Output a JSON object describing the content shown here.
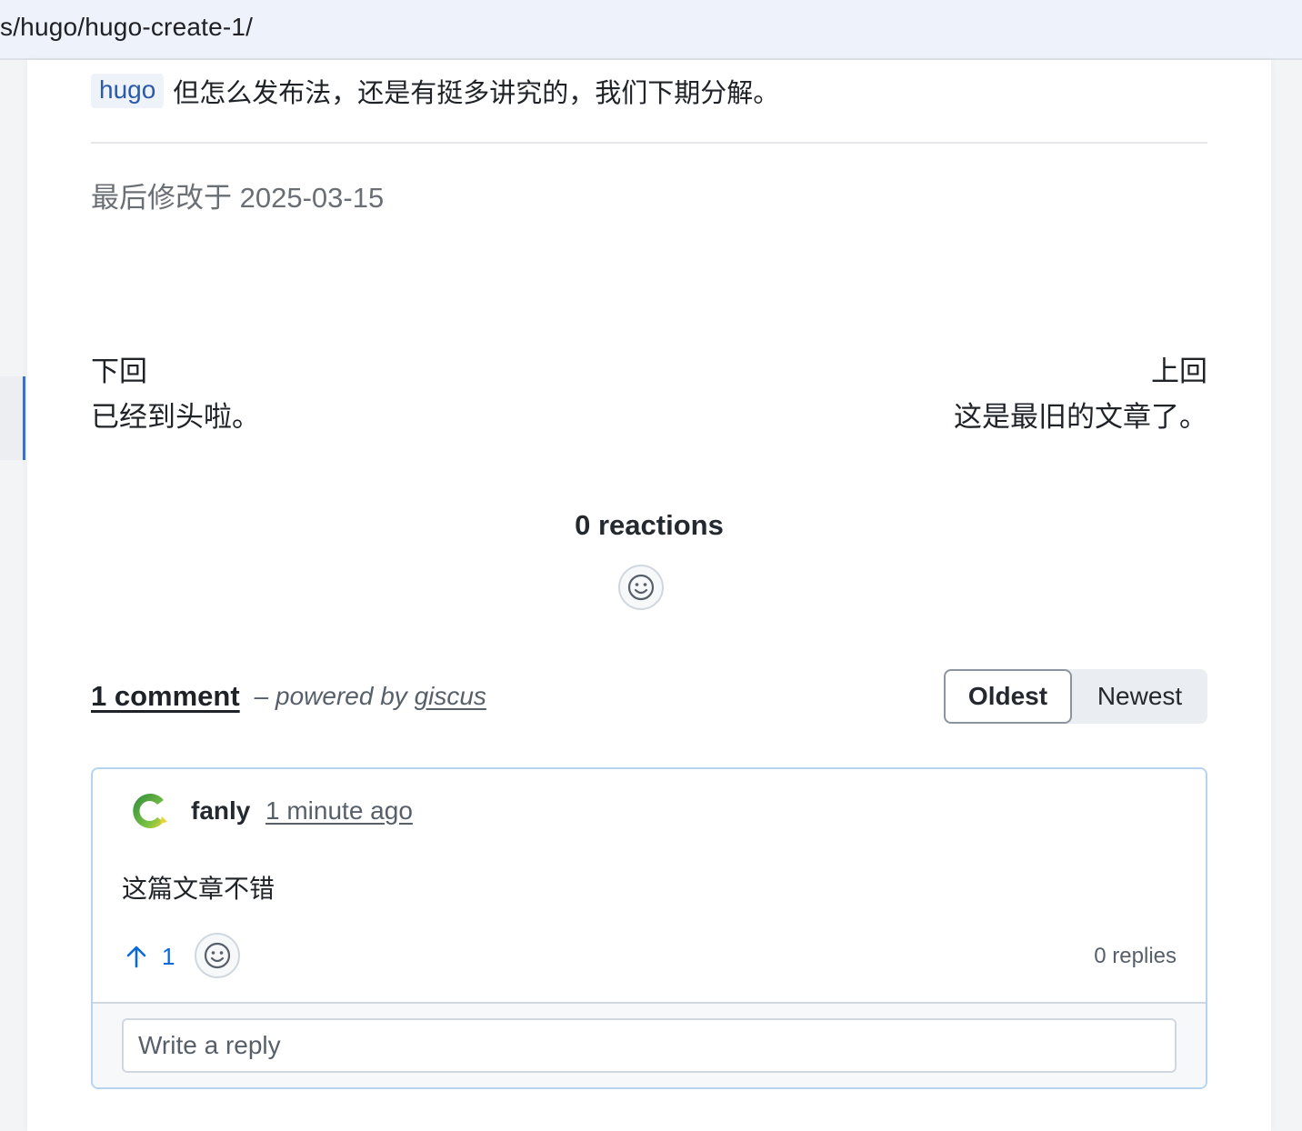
{
  "browser": {
    "url_fragment": "s/hugo/hugo-create-1/"
  },
  "article": {
    "tag": "hugo",
    "last_line": "但怎么发布法，还是有挺多讲究的，我们下期分解。",
    "modified": "最后修改于 2025-03-15"
  },
  "post_nav": {
    "prev_label": "下回",
    "prev_text": "已经到头啦。",
    "next_label": "上回",
    "next_text": "这是最旧的文章了。"
  },
  "reactions": {
    "title": "0 reactions"
  },
  "comments": {
    "count_label": "1 comment",
    "powered_prefix": "– powered by ",
    "powered_name": "giscus",
    "sort_oldest": "Oldest",
    "sort_newest": "Newest",
    "items": [
      {
        "author": "fanly",
        "time": "1 minute ago",
        "body": "这篇文章不错",
        "upvotes": "1",
        "replies": "0 replies"
      }
    ],
    "reply_placeholder": "Write a reply"
  },
  "colors": {
    "accent": "#3a6fd8",
    "link_blue": "#0969da",
    "tag_bg": "#eef2f9",
    "comment_border": "#b6d4f0"
  },
  "icons": {
    "smiley": "smiley-icon",
    "upvote": "arrow-up-icon",
    "avatar": "avatar-logo"
  }
}
